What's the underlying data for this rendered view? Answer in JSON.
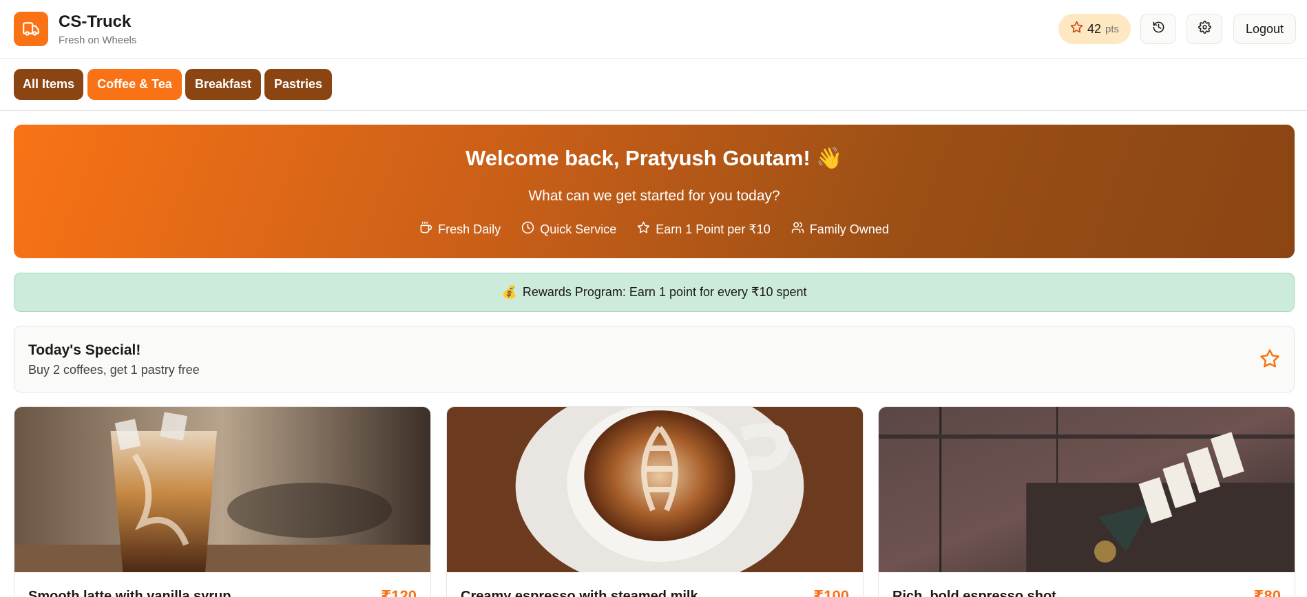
{
  "header": {
    "brand_title": "CS-Truck",
    "brand_subtitle": "Fresh on Wheels",
    "points_value": "42",
    "points_unit": "pts",
    "logout_label": "Logout"
  },
  "tabs": [
    {
      "label": "All Items"
    },
    {
      "label": "Coffee & Tea",
      "active": true
    },
    {
      "label": "Breakfast"
    },
    {
      "label": "Pastries"
    }
  ],
  "hero": {
    "title": "Welcome back, Pratyush Goutam! 👋",
    "subtitle": "What can we get started for you today?",
    "features": [
      {
        "icon": "coffee-cup-icon",
        "label": "Fresh Daily"
      },
      {
        "icon": "clock-icon",
        "label": "Quick Service"
      },
      {
        "icon": "star-icon",
        "label": "Earn 1 Point per ₹10"
      },
      {
        "icon": "users-icon",
        "label": "Family Owned"
      }
    ]
  },
  "rewards": {
    "emoji": "💰",
    "text": "Rewards Program: Earn 1 point for every ₹10 spent"
  },
  "special": {
    "title": "Today's Special!",
    "description": "Buy 2 coffees, get 1 pastry free"
  },
  "menu_items": [
    {
      "name": "Smooth latte with vanilla syrup",
      "price": "₹120"
    },
    {
      "name": "Creamy espresso with steamed milk",
      "price": "₹100"
    },
    {
      "name": "Rich, bold espresso shot",
      "price": "₹80"
    }
  ],
  "colors": {
    "accent": "#f97316",
    "brown": "#8b4513",
    "rewards_bg": "#cdebdb"
  }
}
